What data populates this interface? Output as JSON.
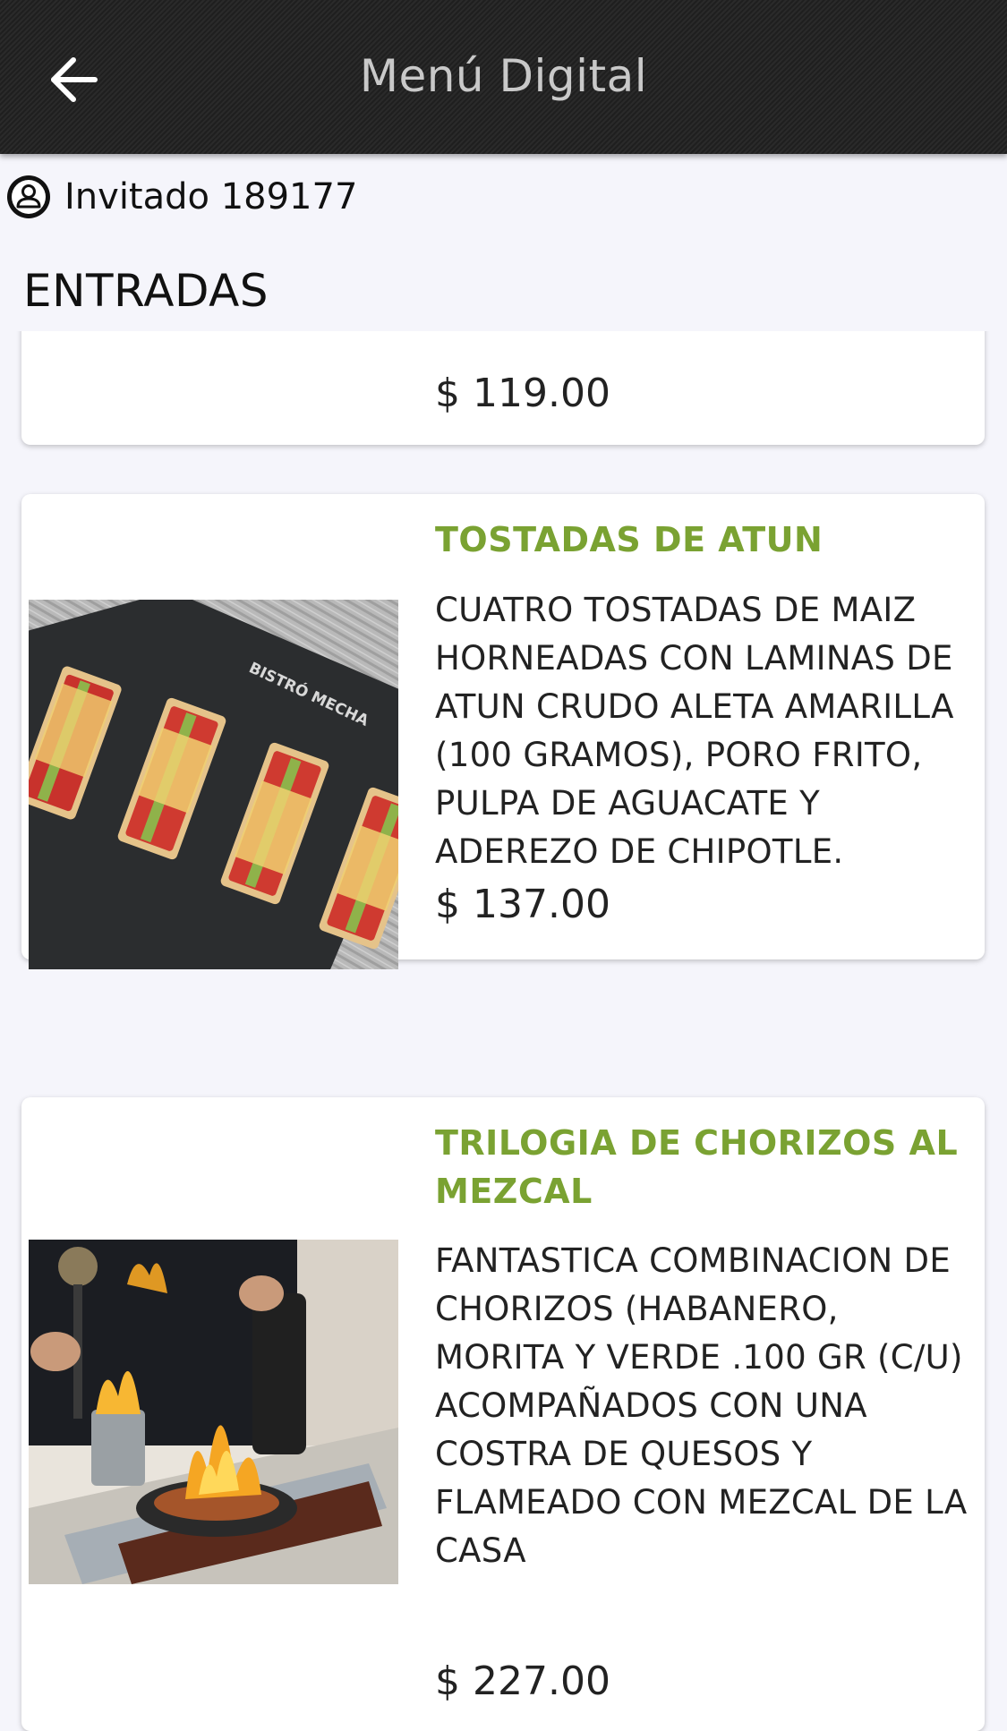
{
  "header": {
    "title": "Menú Digital",
    "back_icon": "arrow-left-icon"
  },
  "guest": {
    "icon": "user-circle-icon",
    "name": "Invitado 189177"
  },
  "section": {
    "title": "ENTRADAS"
  },
  "items": [
    {
      "name": "",
      "description": "",
      "price": "$ 119.00"
    },
    {
      "name": "TOSTADAS DE ATUN",
      "description": "CUATRO TOSTADAS DE MAIZ HORNEADAS CON LAMINAS DE ATUN CRUDO ALETA AMARILLA (100 GRAMOS), PORO FRITO, PULPA DE AGUACATE Y ADEREZO DE CHIPOTLE.",
      "price": "$ 137.00",
      "image_brand": "BISTRÓ MECHA"
    },
    {
      "name": "TRILOGIA DE CHORIZOS AL MEZCAL",
      "description": "FANTASTICA COMBINACION DE CHORIZOS (HABANERO, MORITA Y VERDE .100 GR (C/U) ACOMPAÑADOS CON UNA COSTRA DE QUESOS Y FLAMEADO CON MEZCAL DE LA CASA",
      "price": "$ 227.00"
    }
  ],
  "colors": {
    "header_bg": "#232323",
    "header_text": "#c9c9c9",
    "item_name": "#7aa232",
    "page_bg": "#f5f5fb"
  }
}
